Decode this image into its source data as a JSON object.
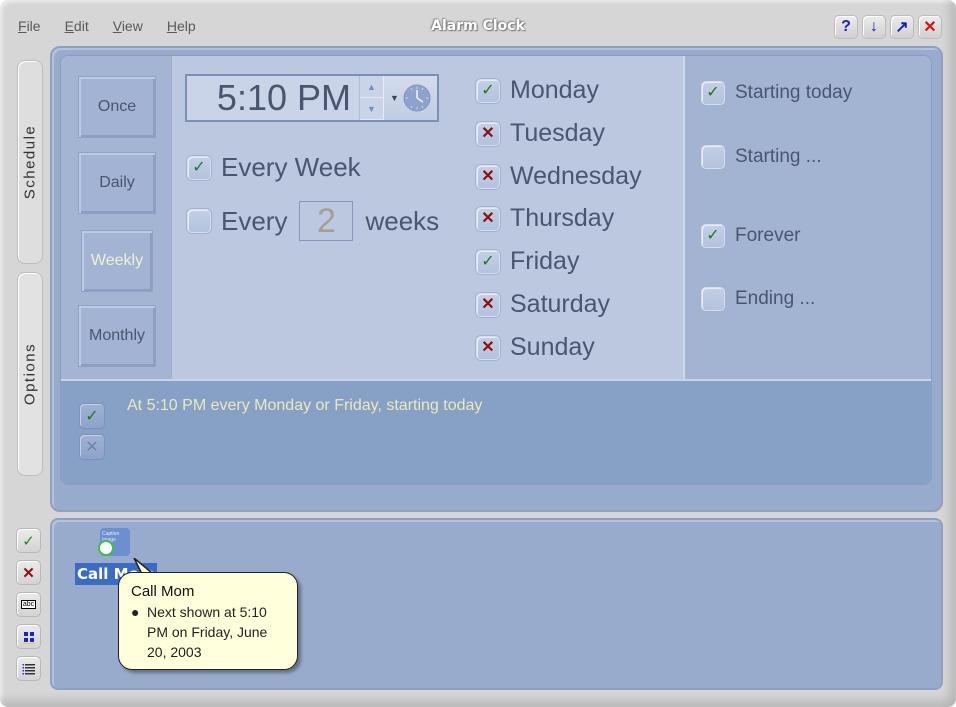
{
  "window": {
    "title": "Alarm Clock",
    "menu": [
      {
        "label": "File",
        "mnemonic": "F",
        "rest": "ile"
      },
      {
        "label": "Edit",
        "mnemonic": "E",
        "rest": "dit"
      },
      {
        "label": "View",
        "mnemonic": "V",
        "rest": "iew"
      },
      {
        "label": "Help",
        "mnemonic": "H",
        "rest": "elp"
      }
    ],
    "title_buttons": [
      {
        "name": "help",
        "glyph": "?",
        "color": "#1a22b8"
      },
      {
        "name": "minimize",
        "glyph": "↓",
        "color": "#1a22b8"
      },
      {
        "name": "maximize",
        "glyph": "↗",
        "color": "#1a22b8"
      },
      {
        "name": "close",
        "glyph": "✕",
        "color": "#e01010"
      }
    ]
  },
  "tabs": [
    {
      "label": "Schedule",
      "active": true
    },
    {
      "label": "Options",
      "active": false
    }
  ],
  "frequency": {
    "buttons": [
      "Once",
      "Daily",
      "Weekly",
      "Monthly"
    ],
    "selected": "Weekly"
  },
  "time": {
    "value": "5:10 PM",
    "up_glyph": "▲",
    "down_glyph": "▼",
    "dropdown_glyph": "▼"
  },
  "recurrence": {
    "every_week": {
      "label": "Every Week",
      "checked": true
    },
    "every_n": {
      "prefix": "Every",
      "value": "2",
      "suffix": "weeks",
      "checked": false
    }
  },
  "days": [
    {
      "label": "Monday",
      "checked": true
    },
    {
      "label": "Tuesday",
      "checked": false
    },
    {
      "label": "Wednesday",
      "checked": false
    },
    {
      "label": "Thursday",
      "checked": false
    },
    {
      "label": "Friday",
      "checked": true
    },
    {
      "label": "Saturday",
      "checked": false
    },
    {
      "label": "Sunday",
      "checked": false
    }
  ],
  "range": [
    {
      "label": "Starting today",
      "checked": true
    },
    {
      "label": "Starting ...",
      "checked": false
    },
    {
      "label": "Forever",
      "checked": true
    },
    {
      "label": "Ending ...",
      "checked": false
    }
  ],
  "summary": {
    "text": "At 5:10 PM every Monday or Friday, starting today",
    "accept_glyph": "✓",
    "reject_glyph": "✕"
  },
  "tools": [
    {
      "name": "accept",
      "glyph": "✓",
      "color": "#1e8a1e"
    },
    {
      "name": "delete",
      "glyph": "✕",
      "color": "#8a1010"
    },
    {
      "name": "caption",
      "glyph": "abc",
      "color": "#000000"
    },
    {
      "name": "icon-view",
      "glyph": "▪▪",
      "color": "#1a22d8"
    },
    {
      "name": "list-view",
      "glyph": "☰",
      "color": "#333333"
    }
  ],
  "alarm_item": {
    "label": "Call Mom",
    "icon_caption": "Caption Image",
    "tooltip_title": "Call Mom",
    "tooltip_text": "Next shown at 5:10 PM on Friday, June 20, 2003"
  },
  "colors": {
    "check": "#1e7a1e",
    "cross": "#8a1010",
    "summary_text": "#ebe9bc",
    "selected_label_bg": "#3a6cc4"
  }
}
